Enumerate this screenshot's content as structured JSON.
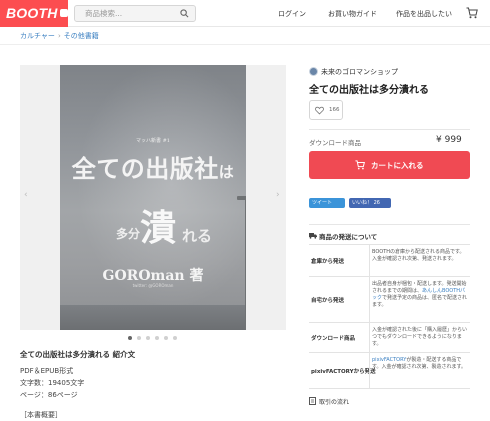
{
  "header": {
    "logo": "BOOTH",
    "search_placeholder": "商品検索...",
    "nav": [
      "ログイン",
      "お買い物ガイド",
      "作品を出品したい"
    ]
  },
  "breadcrumb": [
    "カルチャー",
    "その他書籍"
  ],
  "cover": {
    "series": "マッハ新書 #1",
    "title_line1_big": "全ての出版社",
    "title_line1_small": "は",
    "title_line2_pre": "多分",
    "title_line2_main": "潰",
    "title_line2_post": "れる",
    "author": "GOROman 著",
    "twitter": "twitter: @GOROman"
  },
  "gallery": {
    "dot_count": 6,
    "active_dot": 0
  },
  "description": {
    "title": "全ての出版社は多分潰れる 紹介文",
    "lines": [
      "PDF＆EPUB形式",
      "文字数：19405文字",
      "ページ：86ページ",
      "［本書概要］"
    ]
  },
  "product": {
    "shop_name": "未来のゴロマンショップ",
    "title": "全ての出版社は多分潰れる",
    "likes": "166",
    "download_label": "ダウンロード商品",
    "price": "¥ 999",
    "cart_button": "カートに入れる",
    "tweet_label": "ツイート",
    "facebook_label": "いいね！ 26"
  },
  "shipping": {
    "heading": "商品の発送について",
    "rows": [
      {
        "method": "倉庫から発送",
        "desc": "BOOTHの倉庫から配送される商品です。入金が確認され次第、発送されます。"
      },
      {
        "method": "自宅から発送",
        "desc_pre": "出品者自身が梱包・配送します。発送開始されるまでの期間は、",
        "desc_link": "あんしんBOOTHパック",
        "desc_post": "で発送予定の商品は、匿名で配送されます。"
      },
      {
        "method": "ダウンロード商品",
        "desc": "入金が確認された後に「購入履歴」からいつでもダウンロードできるようになります。"
      },
      {
        "method": "pixivFACTORYから発送",
        "desc_link": "pixivFACTORY",
        "desc_post": "が製造・配送する商品です。入金が確認され次第、製造されます。"
      }
    ],
    "flow_link": "取引の流れ"
  },
  "colors": {
    "brand": "#fc4d50",
    "cart_button": "#f04a53",
    "link": "#3a7fc1"
  }
}
